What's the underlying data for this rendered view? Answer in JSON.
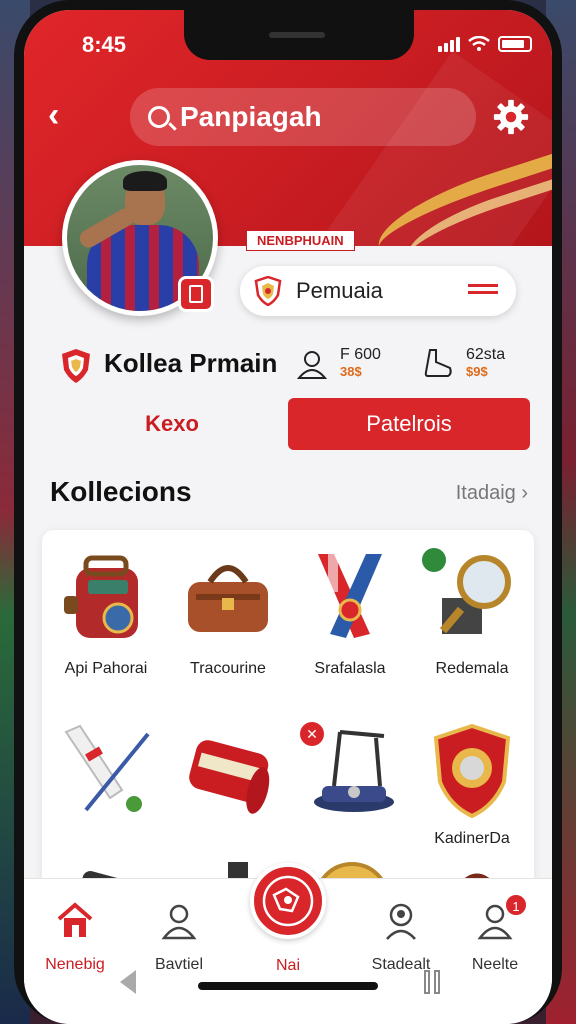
{
  "status": {
    "time": "8:45"
  },
  "topbar": {
    "search_text": "Panpiagah"
  },
  "profile": {
    "role_tag": "NENBPHUAIN",
    "role_label": "Pemuaia",
    "name": "Kollea Prmain",
    "stat1": {
      "value": "F 600",
      "sub": "38$"
    },
    "stat2": {
      "value": "62sta",
      "sub": "$9$"
    }
  },
  "tabs": {
    "left": "Kexo",
    "right": "Patelrois"
  },
  "collections": {
    "title": "Kollecions",
    "see_all": "Itadaig",
    "items": [
      {
        "label": "Api Pahorai",
        "icon": "backpack-icon"
      },
      {
        "label": "Tracourine",
        "icon": "bag-icon"
      },
      {
        "label": "Srafalasla",
        "icon": "scarf-icon"
      },
      {
        "label": "Redemala",
        "icon": "magnifier-icon"
      },
      {
        "label": "",
        "icon": "cricket-bat-icon"
      },
      {
        "label": "",
        "icon": "can-icon"
      },
      {
        "label": "",
        "icon": "stand-icon"
      },
      {
        "label": "KadinerDa",
        "icon": "shield-badge-icon"
      },
      {
        "label": "",
        "icon": "device-icon"
      },
      {
        "label": "",
        "icon": "bottle-icon"
      },
      {
        "label": "",
        "icon": "medal-icon"
      },
      {
        "label": "",
        "icon": "bag-small-icon"
      }
    ]
  },
  "nav": {
    "items": [
      {
        "label": "Nenebig"
      },
      {
        "label": "Bavtiel"
      },
      {
        "label": "Nai"
      },
      {
        "label": "Stadealt"
      },
      {
        "label": "Neelte"
      }
    ],
    "notif_count": "1"
  },
  "colors": {
    "brand": "#d8262b",
    "accent": "#e8b94a"
  }
}
